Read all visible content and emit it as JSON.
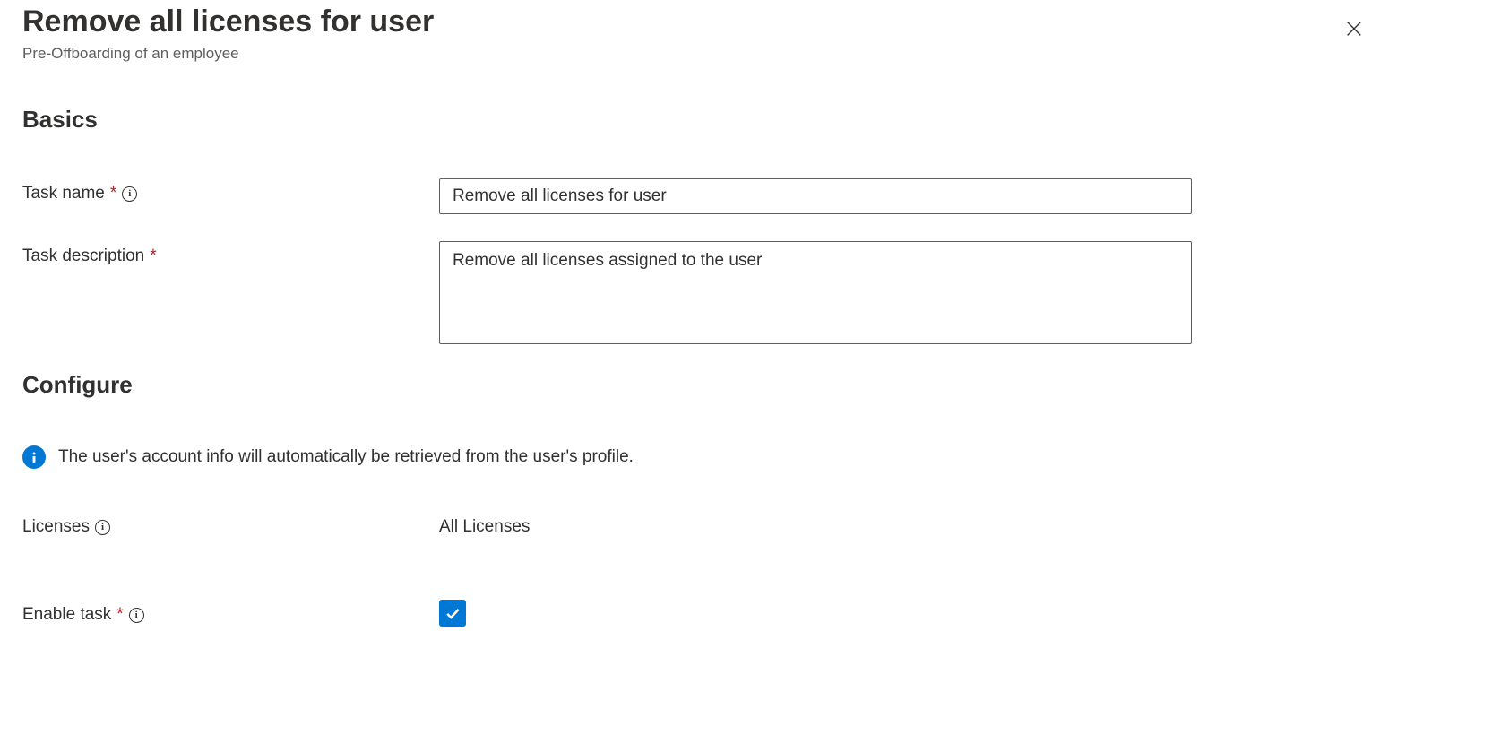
{
  "header": {
    "title": "Remove all licenses for user",
    "subtitle": "Pre-Offboarding of an employee"
  },
  "sections": {
    "basics": {
      "title": "Basics",
      "taskNameLabel": "Task name",
      "taskNameValue": "Remove all licenses for user",
      "taskDescriptionLabel": "Task description",
      "taskDescriptionValue": "Remove all licenses assigned to the user"
    },
    "configure": {
      "title": "Configure",
      "infoText": "The user's account info will automatically be retrieved from the user's profile.",
      "licensesLabel": "Licenses",
      "licensesValue": "All Licenses",
      "enableTaskLabel": "Enable task",
      "enableTaskChecked": true
    }
  }
}
